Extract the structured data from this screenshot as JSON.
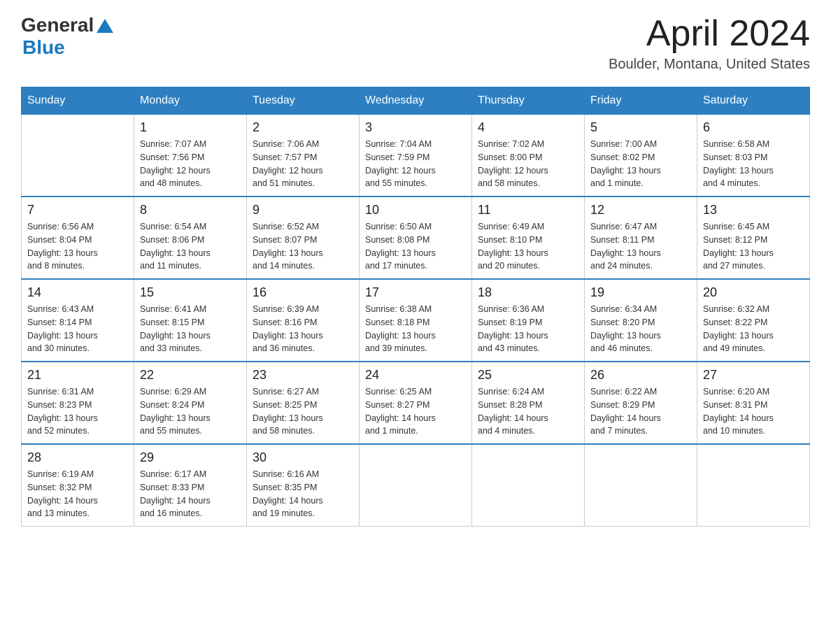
{
  "header": {
    "logo_general": "General",
    "logo_blue": "Blue",
    "month_title": "April 2024",
    "location": "Boulder, Montana, United States"
  },
  "days_of_week": [
    "Sunday",
    "Monday",
    "Tuesday",
    "Wednesday",
    "Thursday",
    "Friday",
    "Saturday"
  ],
  "weeks": [
    [
      {
        "day": "",
        "info": ""
      },
      {
        "day": "1",
        "info": "Sunrise: 7:07 AM\nSunset: 7:56 PM\nDaylight: 12 hours\nand 48 minutes."
      },
      {
        "day": "2",
        "info": "Sunrise: 7:06 AM\nSunset: 7:57 PM\nDaylight: 12 hours\nand 51 minutes."
      },
      {
        "day": "3",
        "info": "Sunrise: 7:04 AM\nSunset: 7:59 PM\nDaylight: 12 hours\nand 55 minutes."
      },
      {
        "day": "4",
        "info": "Sunrise: 7:02 AM\nSunset: 8:00 PM\nDaylight: 12 hours\nand 58 minutes."
      },
      {
        "day": "5",
        "info": "Sunrise: 7:00 AM\nSunset: 8:02 PM\nDaylight: 13 hours\nand 1 minute."
      },
      {
        "day": "6",
        "info": "Sunrise: 6:58 AM\nSunset: 8:03 PM\nDaylight: 13 hours\nand 4 minutes."
      }
    ],
    [
      {
        "day": "7",
        "info": "Sunrise: 6:56 AM\nSunset: 8:04 PM\nDaylight: 13 hours\nand 8 minutes."
      },
      {
        "day": "8",
        "info": "Sunrise: 6:54 AM\nSunset: 8:06 PM\nDaylight: 13 hours\nand 11 minutes."
      },
      {
        "day": "9",
        "info": "Sunrise: 6:52 AM\nSunset: 8:07 PM\nDaylight: 13 hours\nand 14 minutes."
      },
      {
        "day": "10",
        "info": "Sunrise: 6:50 AM\nSunset: 8:08 PM\nDaylight: 13 hours\nand 17 minutes."
      },
      {
        "day": "11",
        "info": "Sunrise: 6:49 AM\nSunset: 8:10 PM\nDaylight: 13 hours\nand 20 minutes."
      },
      {
        "day": "12",
        "info": "Sunrise: 6:47 AM\nSunset: 8:11 PM\nDaylight: 13 hours\nand 24 minutes."
      },
      {
        "day": "13",
        "info": "Sunrise: 6:45 AM\nSunset: 8:12 PM\nDaylight: 13 hours\nand 27 minutes."
      }
    ],
    [
      {
        "day": "14",
        "info": "Sunrise: 6:43 AM\nSunset: 8:14 PM\nDaylight: 13 hours\nand 30 minutes."
      },
      {
        "day": "15",
        "info": "Sunrise: 6:41 AM\nSunset: 8:15 PM\nDaylight: 13 hours\nand 33 minutes."
      },
      {
        "day": "16",
        "info": "Sunrise: 6:39 AM\nSunset: 8:16 PM\nDaylight: 13 hours\nand 36 minutes."
      },
      {
        "day": "17",
        "info": "Sunrise: 6:38 AM\nSunset: 8:18 PM\nDaylight: 13 hours\nand 39 minutes."
      },
      {
        "day": "18",
        "info": "Sunrise: 6:36 AM\nSunset: 8:19 PM\nDaylight: 13 hours\nand 43 minutes."
      },
      {
        "day": "19",
        "info": "Sunrise: 6:34 AM\nSunset: 8:20 PM\nDaylight: 13 hours\nand 46 minutes."
      },
      {
        "day": "20",
        "info": "Sunrise: 6:32 AM\nSunset: 8:22 PM\nDaylight: 13 hours\nand 49 minutes."
      }
    ],
    [
      {
        "day": "21",
        "info": "Sunrise: 6:31 AM\nSunset: 8:23 PM\nDaylight: 13 hours\nand 52 minutes."
      },
      {
        "day": "22",
        "info": "Sunrise: 6:29 AM\nSunset: 8:24 PM\nDaylight: 13 hours\nand 55 minutes."
      },
      {
        "day": "23",
        "info": "Sunrise: 6:27 AM\nSunset: 8:25 PM\nDaylight: 13 hours\nand 58 minutes."
      },
      {
        "day": "24",
        "info": "Sunrise: 6:25 AM\nSunset: 8:27 PM\nDaylight: 14 hours\nand 1 minute."
      },
      {
        "day": "25",
        "info": "Sunrise: 6:24 AM\nSunset: 8:28 PM\nDaylight: 14 hours\nand 4 minutes."
      },
      {
        "day": "26",
        "info": "Sunrise: 6:22 AM\nSunset: 8:29 PM\nDaylight: 14 hours\nand 7 minutes."
      },
      {
        "day": "27",
        "info": "Sunrise: 6:20 AM\nSunset: 8:31 PM\nDaylight: 14 hours\nand 10 minutes."
      }
    ],
    [
      {
        "day": "28",
        "info": "Sunrise: 6:19 AM\nSunset: 8:32 PM\nDaylight: 14 hours\nand 13 minutes."
      },
      {
        "day": "29",
        "info": "Sunrise: 6:17 AM\nSunset: 8:33 PM\nDaylight: 14 hours\nand 16 minutes."
      },
      {
        "day": "30",
        "info": "Sunrise: 6:16 AM\nSunset: 8:35 PM\nDaylight: 14 hours\nand 19 minutes."
      },
      {
        "day": "",
        "info": ""
      },
      {
        "day": "",
        "info": ""
      },
      {
        "day": "",
        "info": ""
      },
      {
        "day": "",
        "info": ""
      }
    ]
  ]
}
